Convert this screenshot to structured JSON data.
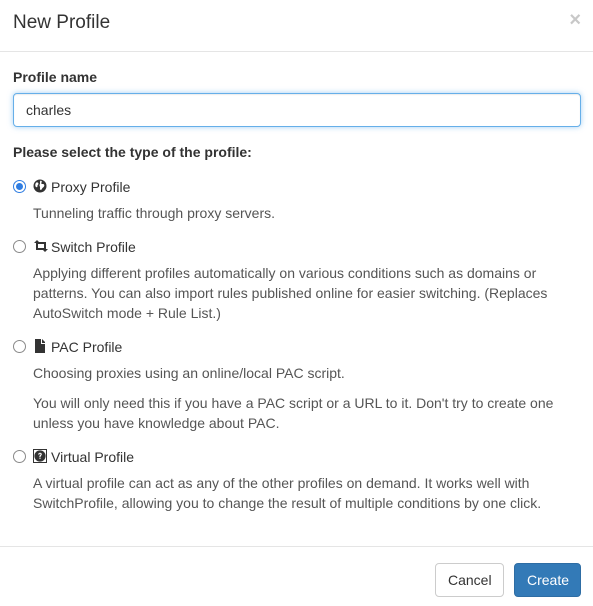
{
  "dialog": {
    "title": "New Profile",
    "close_symbol": "×"
  },
  "name_field": {
    "label": "Profile name",
    "value": "charles",
    "focused": true
  },
  "type_section": {
    "label": "Please select the type of the profile:"
  },
  "options": [
    {
      "title": "Proxy Profile",
      "icon": "globe-icon",
      "checked": true,
      "descriptions": [
        "Tunneling traffic through proxy servers."
      ]
    },
    {
      "title": "Switch Profile",
      "icon": "retweet-icon",
      "checked": false,
      "descriptions": [
        "Applying different profiles automatically on various conditions such as domains or patterns. You can also import rules published online for easier switching. (Replaces AutoSwitch mode + Rule List.)"
      ]
    },
    {
      "title": "PAC Profile",
      "icon": "file-icon",
      "checked": false,
      "descriptions": [
        "Choosing proxies using an online/local PAC script.",
        "You will only need this if you have a PAC script or a URL to it. Don't try to create one unless you have knowledge about PAC."
      ]
    },
    {
      "title": "Virtual Profile",
      "icon": "question-icon",
      "checked": false,
      "descriptions": [
        "A virtual profile can act as any of the other profiles on demand. It works well with SwitchProfile, allowing you to change the result of multiple conditions by one click."
      ]
    }
  ],
  "footer": {
    "cancel_label": "Cancel",
    "create_label": "Create"
  },
  "colors": {
    "primary": "#337ab7",
    "focus_border": "#66afe9",
    "radio_checked": "#2f7de1"
  }
}
